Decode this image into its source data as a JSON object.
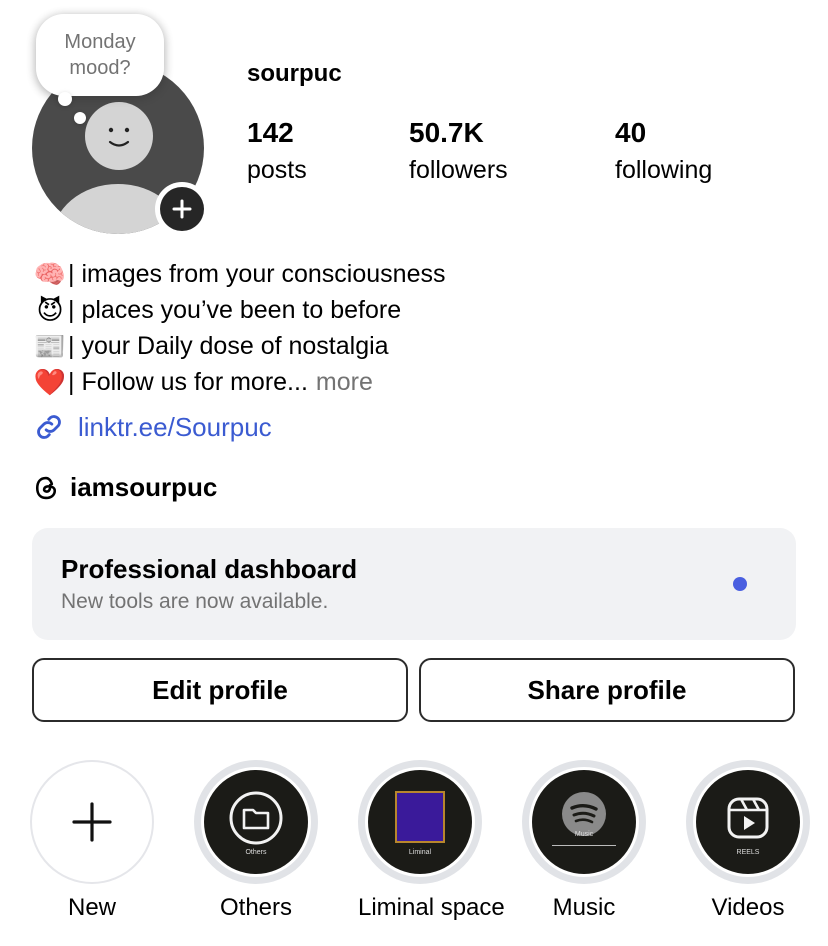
{
  "profile": {
    "username": "sourpuc",
    "note_line1": "Monday",
    "note_line2": "mood?",
    "stats": {
      "posts_count": "142",
      "posts_label": "posts",
      "followers_count": "50.7K",
      "followers_label": "followers",
      "following_count": "40",
      "following_label": "following"
    }
  },
  "bio": {
    "lines": [
      {
        "emoji": "🧠",
        "text": "| images from your consciousness"
      },
      {
        "emoji": "😈",
        "text": "| places you’ve been to before"
      },
      {
        "emoji": "📰",
        "text": "| your Daily dose of nostalgia"
      },
      {
        "emoji": "❤️",
        "text": "| Follow us for more..."
      }
    ],
    "more_label": "more",
    "link": "linktr.ee/Sourpuc",
    "threads_handle": "iamsourpuc"
  },
  "dashboard": {
    "title": "Professional dashboard",
    "subtitle": "New tools are now available.",
    "dot_color": "#4a5fe0"
  },
  "buttons": {
    "edit": "Edit profile",
    "share": "Share profile"
  },
  "highlights": [
    {
      "label": "New",
      "icon": "plus-icon"
    },
    {
      "label": "Others",
      "icon": "folder-icon",
      "cover_text": "Others"
    },
    {
      "label": "Liminal space",
      "icon": "liminal-cover",
      "cover_text": "Liminal"
    },
    {
      "label": "Music",
      "icon": "spotify-icon",
      "cover_text": "Music"
    },
    {
      "label": "Videos",
      "icon": "reels-icon",
      "cover_text": "REELS"
    }
  ]
}
